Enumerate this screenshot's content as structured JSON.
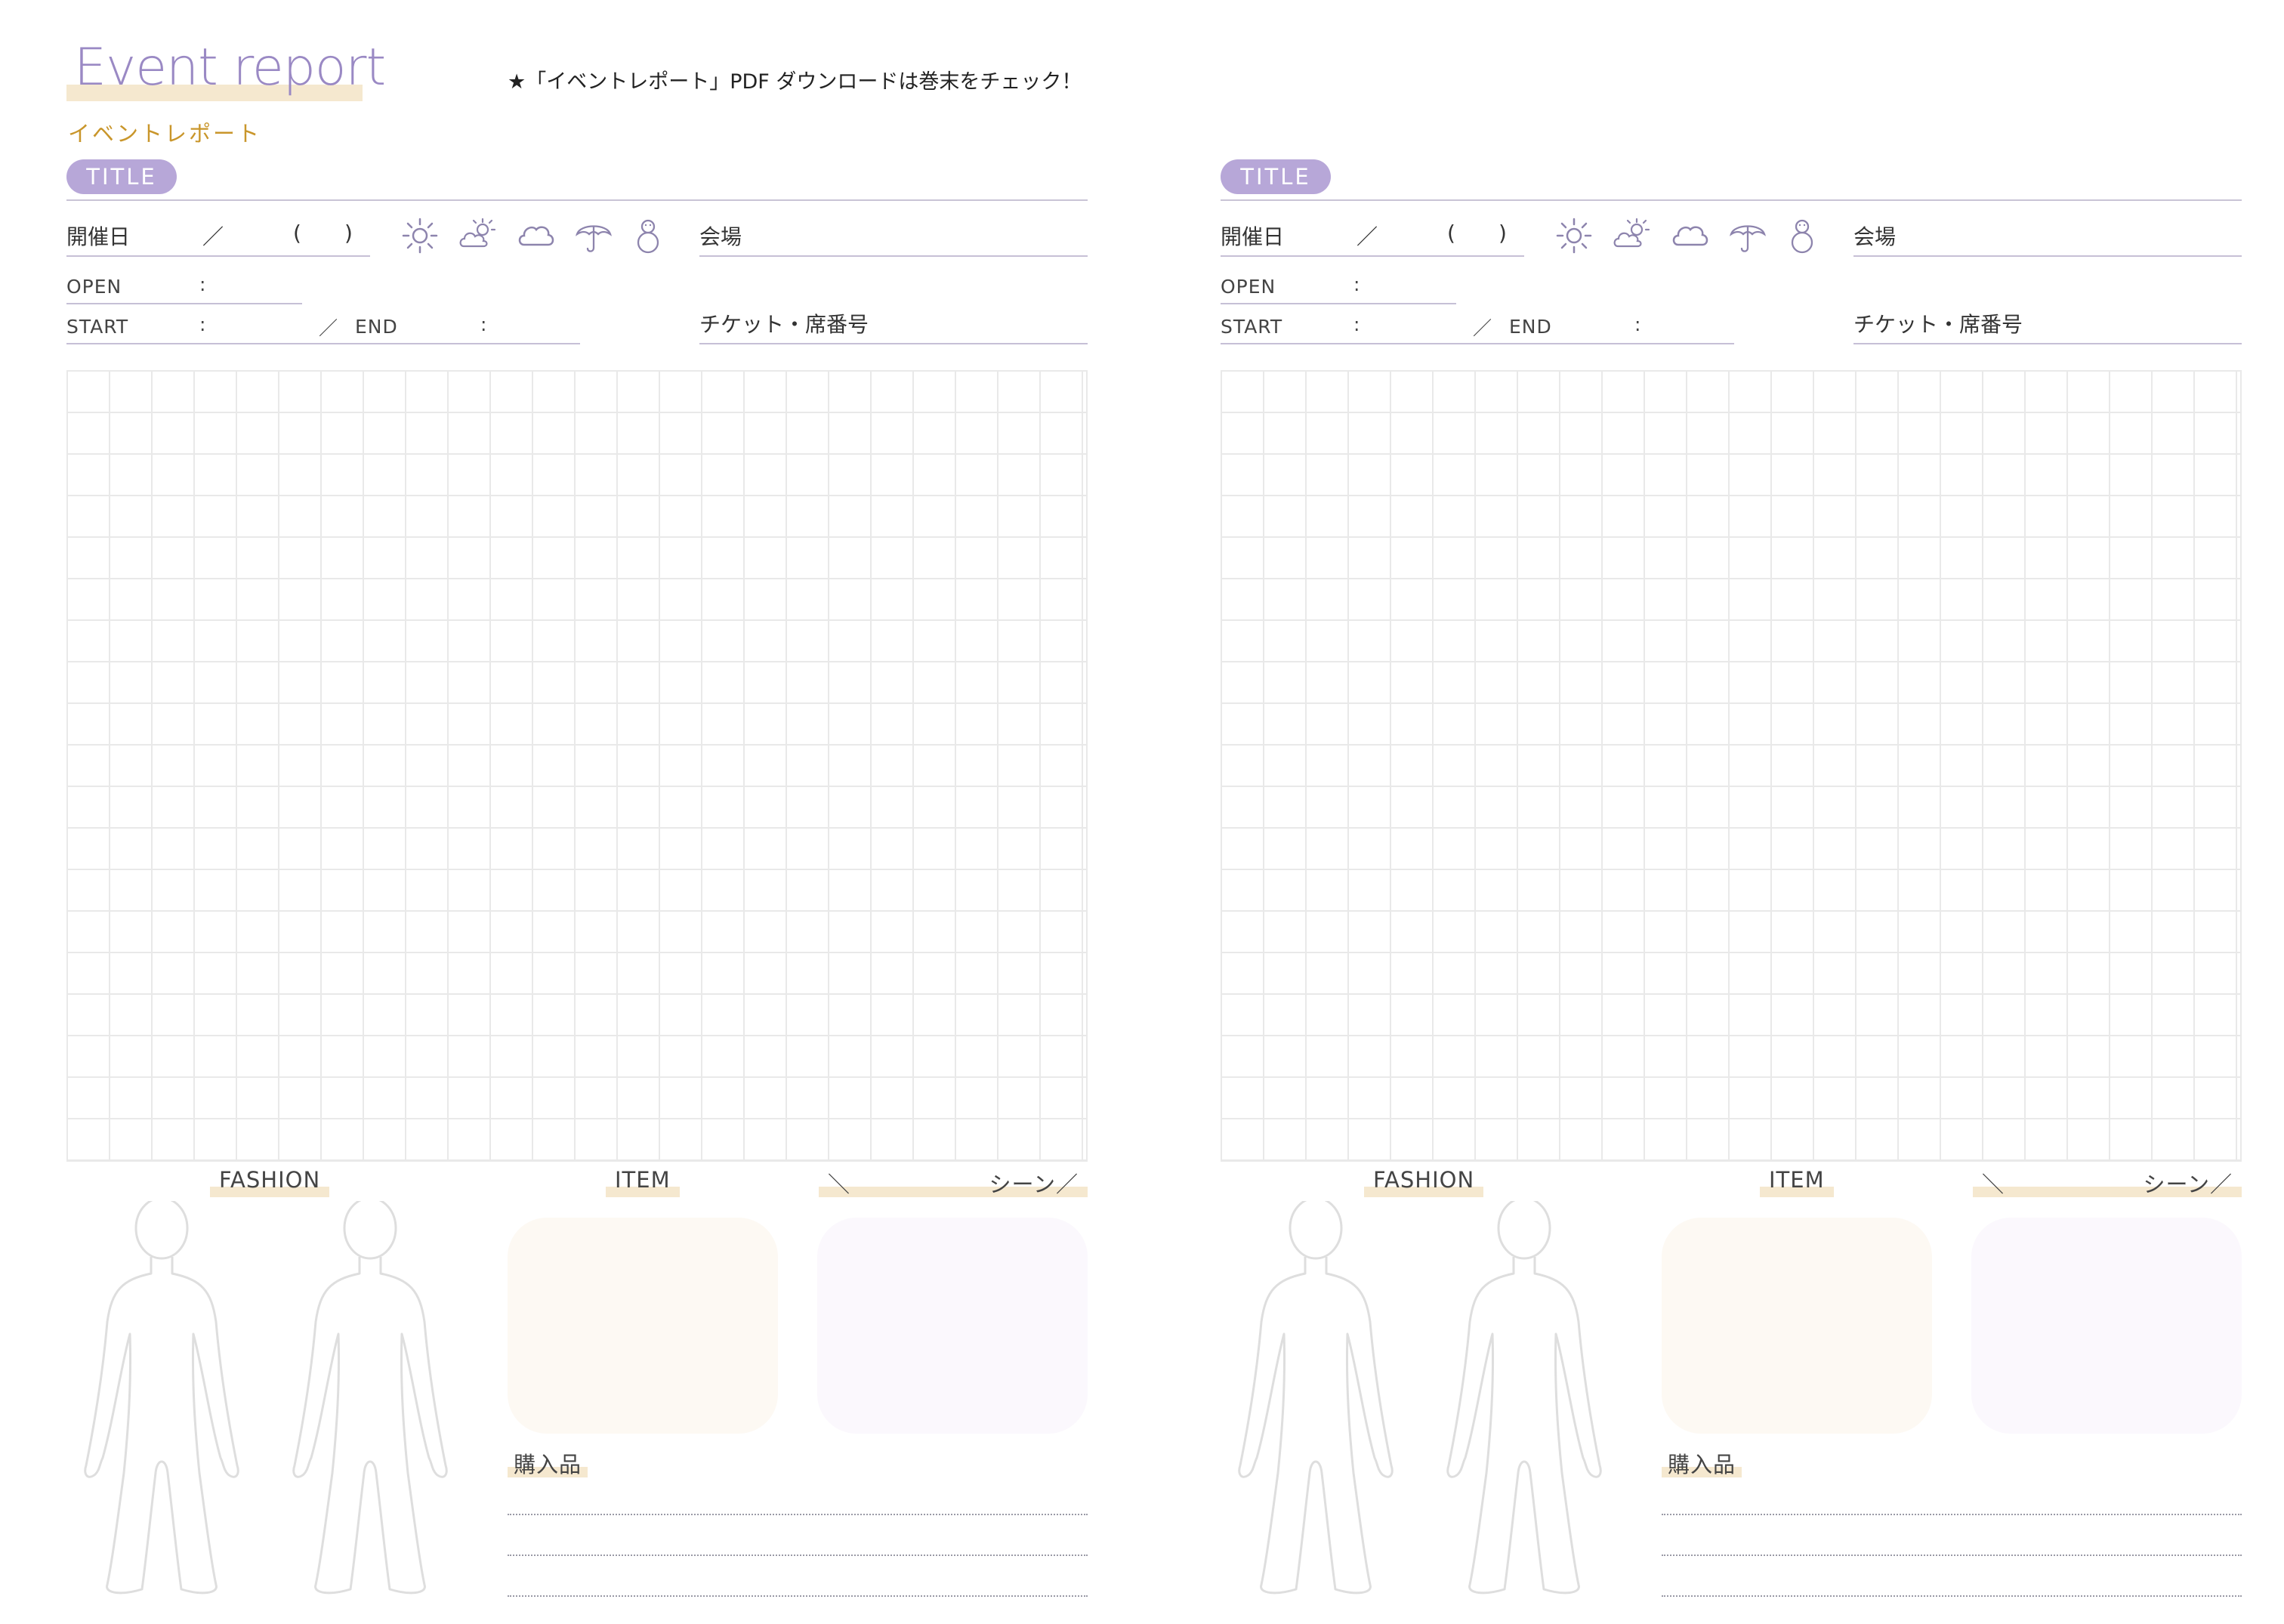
{
  "header": {
    "title": "Event report",
    "subtitle": "イベントレポート",
    "note": "★「イベントレポート」PDF ダウンロードは巻末をチェック！"
  },
  "pages": [
    {
      "title_label": "TITLE",
      "date_label": "開催日",
      "date_slash": "／",
      "date_paren_open": "(",
      "date_paren_close": ")",
      "weather_icons": [
        "sun-icon",
        "partly-cloudy-icon",
        "cloud-icon",
        "umbrella-icon",
        "snowman-icon"
      ],
      "venue_label": "会場",
      "open_label": "OPEN",
      "open_colon": ":",
      "start_label": "START",
      "start_colon": ":",
      "separator": "／",
      "end_label": "END",
      "end_colon": ":",
      "ticket_label": "チケット・席番号",
      "fashion_label": "FASHION",
      "item_label": "ITEM",
      "scene_left": "＼",
      "scene_label": "シーン／",
      "purchase_label": "購入品"
    },
    {
      "title_label": "TITLE",
      "date_label": "開催日",
      "date_slash": "／",
      "date_paren_open": "(",
      "date_paren_close": ")",
      "weather_icons": [
        "sun-icon",
        "partly-cloudy-icon",
        "cloud-icon",
        "umbrella-icon",
        "snowman-icon"
      ],
      "venue_label": "会場",
      "open_label": "OPEN",
      "open_colon": ":",
      "start_label": "START",
      "start_colon": ":",
      "separator": "／",
      "end_label": "END",
      "end_colon": ":",
      "ticket_label": "チケット・席番号",
      "fashion_label": "FASHION",
      "item_label": "ITEM",
      "scene_left": "＼",
      "scene_label": "シーン／",
      "purchase_label": "購入品"
    }
  ],
  "colors": {
    "accent_purple": "#b7a7d8",
    "title_purple": "#9a89c4",
    "subtitle_gold": "#c9962b",
    "highlight_beige": "#f5e8cf",
    "grid_line": "#e9e9e9"
  }
}
